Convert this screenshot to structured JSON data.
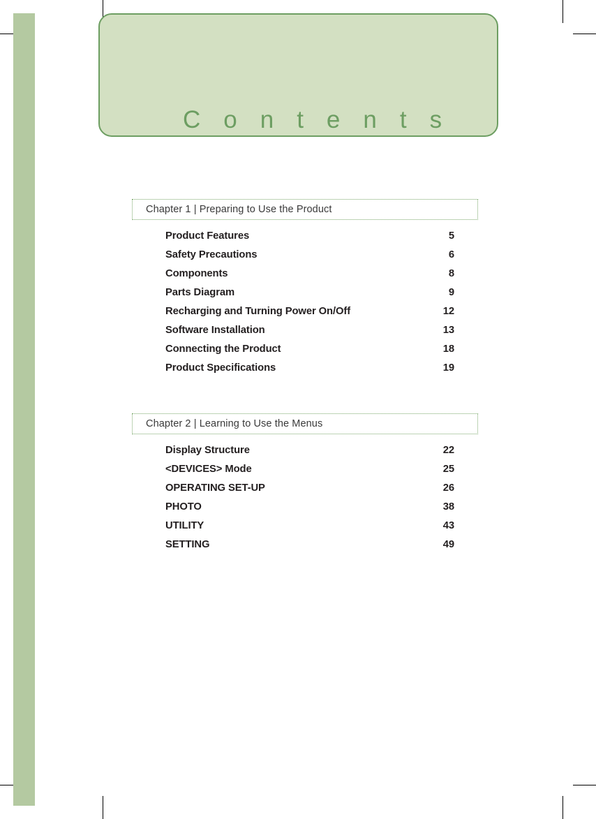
{
  "page": {
    "title": "Contents"
  },
  "chapters": [
    {
      "heading": "Chapter 1 | Preparing to Use the Product",
      "entries": [
        {
          "title": "Product Features",
          "page": "5"
        },
        {
          "title": "Safety Precautions",
          "page": "6"
        },
        {
          "title": "Components",
          "page": "8"
        },
        {
          "title": "Parts Diagram",
          "page": "9"
        },
        {
          "title": "Recharging and Turning Power On/Off",
          "page": "12"
        },
        {
          "title": "Software Installation",
          "page": "13"
        },
        {
          "title": "Connecting the Product",
          "page": "18"
        },
        {
          "title": "Product Specifications",
          "page": "19"
        }
      ]
    },
    {
      "heading": "Chapter 2 | Learning to Use the Menus",
      "entries": [
        {
          "title": "Display Structure",
          "page": "22"
        },
        {
          "title": "<DEVICES> Mode",
          "page": "25"
        },
        {
          "title": "OPERATING SET-UP",
          "page": "26"
        },
        {
          "title": "PHOTO",
          "page": "38"
        },
        {
          "title": "UTILITY",
          "page": "43"
        },
        {
          "title": "SETTING",
          "page": "49"
        }
      ]
    }
  ],
  "colors": {
    "banner_fill": "#d3e0c2",
    "banner_border": "#6d9e62",
    "title_text": "#6d9e62",
    "side_band": "#b4c9a1",
    "dotted_border": "#7ba86b",
    "entry_text": "#231f20",
    "heading_text": "#3a3a3a"
  }
}
